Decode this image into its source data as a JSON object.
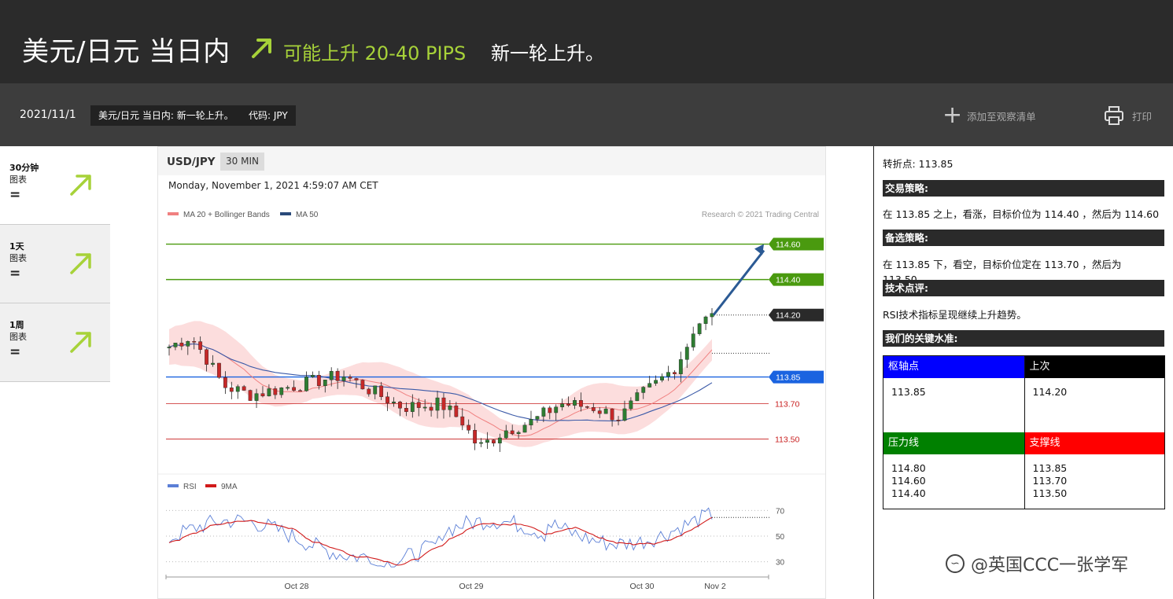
{
  "header": {
    "title": "美元/日元 当日内",
    "forecast": "可能上升 20-40 PIPS",
    "subtitle": "新一轮上升。",
    "accent": "#a7d239"
  },
  "toolbar": {
    "date": "2021/11/1",
    "tag_title": "美元/日元 当日内: 新一轮上升。",
    "tag_code": "代码: JPY",
    "watch_label": "添加至观察清单",
    "print_label": "打印"
  },
  "sidebar": {
    "items": [
      {
        "name": "30分钟",
        "label": "图表",
        "trend": "=",
        "icon": "up-right-arrow-icon"
      },
      {
        "name": "1天",
        "label": "图表",
        "trend": "=",
        "icon": "up-right-arrow-icon"
      },
      {
        "name": "1周",
        "label": "图表",
        "trend": "=",
        "icon": "up-right-arrow-icon"
      }
    ]
  },
  "chart_panel": {
    "symbol": "USD/JPY",
    "timeframe": "30 MIN",
    "timestamp": "Monday, November 1, 2021 4:59:07 AM CET",
    "legend_main": [
      "MA 20 + Bollinger Bands",
      "MA 50"
    ],
    "copyright": "Research © 2021 Trading Central",
    "legend_rsi": [
      "RSI",
      "9MA"
    ]
  },
  "chart_data": [
    {
      "type": "candlestick",
      "title": "USD/JPY",
      "ylim": [
        113.32,
        114.74
      ],
      "levels": [
        {
          "value": 114.6,
          "label": "114.60",
          "kind": "resistance",
          "color": "#4a9a0f"
        },
        {
          "value": 114.4,
          "label": "114.40",
          "kind": "resistance",
          "color": "#4a9a0f"
        },
        {
          "value": 114.2,
          "label": "114.20",
          "kind": "last",
          "color": "#2a2a2a"
        },
        {
          "value": 113.85,
          "label": "113.85",
          "kind": "pivot",
          "color": "#1a63e0"
        },
        {
          "value": 113.7,
          "label": "113.70",
          "kind": "support",
          "color": "#c81e1e"
        },
        {
          "value": 113.5,
          "label": "113.50",
          "kind": "support",
          "color": "#c81e1e"
        }
      ],
      "series": [
        {
          "name": "MA 20 + Bollinger Bands",
          "color": "#f08080"
        },
        {
          "name": "MA 50",
          "color": "#3b5aa8"
        }
      ],
      "forecast_arrow": {
        "from": 114.2,
        "to": 114.6
      },
      "x_ticks": [
        "Oct 28",
        "Oct 29",
        "Oct 30",
        "Nov 2"
      ]
    },
    {
      "type": "line",
      "title": "RSI",
      "ylim": [
        20,
        80
      ],
      "y_ticks": [
        70,
        50,
        30
      ],
      "series": [
        {
          "name": "RSI",
          "color": "#5b7fd6"
        },
        {
          "name": "9MA",
          "color": "#d11a1a"
        }
      ]
    }
  ],
  "right_panel": {
    "pivot_text": "转折点: 113.85",
    "strategy_title": "交易策略:",
    "strategy_text": "在 113.85 之上，看涨，目标价位为 114.40 ，然后为 114.60 。",
    "alt_title": "备选策略:",
    "alt_text": "在 113.85 下，看空，目标价位定在 113.70 ，然后为 113.50。",
    "comment_title": "技术点评:",
    "comment_text": "RSI技术指标呈现继续上升趋势。",
    "levels_title": "我们的关键水准:",
    "pivot_head": "枢轴点",
    "last_head": "上次",
    "pivot_val": "113.85",
    "last_val": "114.20",
    "res_head": "压力线",
    "sup_head": "支撑线",
    "res_vals": [
      "114.80",
      "114.60",
      "114.40"
    ],
    "sup_vals": [
      "113.85",
      "113.70",
      "113.50"
    ],
    "colors": {
      "pivot": "#0000ff",
      "last": "#000000",
      "resistance": "#008000",
      "support": "#ff0000"
    }
  },
  "watermark": "@英国CCC一张学军"
}
